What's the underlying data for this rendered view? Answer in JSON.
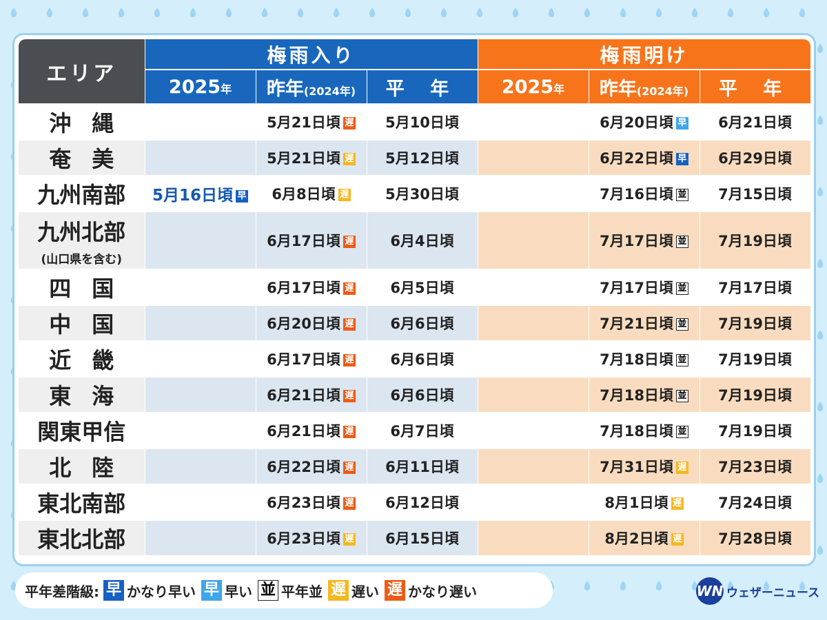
{
  "header": {
    "area_label": "エリア",
    "rainy_start_label": "梅雨入り",
    "rainy_end_label": "梅雨明け",
    "col_this_year": "2025",
    "col_year_unit": "年",
    "col_last_year": "昨年",
    "col_last_year_note": "(2024年)",
    "col_normal": "平 年"
  },
  "rows": [
    {
      "area": "沖縄",
      "spaced": true,
      "note": "",
      "in_2025": "",
      "in_2025_badge": "",
      "in_2024": "5月21日頃",
      "in_2024_badge": "遅",
      "in_2024_level": "very-late",
      "in_normal": "5月10日頃",
      "out_2025": "",
      "out_2024": "6月20日頃",
      "out_2024_badge": "早",
      "out_2024_level": "early",
      "out_normal": "6月21日頃"
    },
    {
      "area": "奄美",
      "spaced": true,
      "note": "",
      "in_2025": "",
      "in_2025_badge": "",
      "in_2024": "5月21日頃",
      "in_2024_badge": "遅",
      "in_2024_level": "late",
      "in_normal": "5月12日頃",
      "out_2025": "",
      "out_2024": "6月22日頃",
      "out_2024_badge": "早",
      "out_2024_level": "very-early",
      "out_normal": "6月29日頃"
    },
    {
      "area": "九州南部",
      "spaced": false,
      "note": "",
      "in_2025": "5月16日頃",
      "in_2025_badge": "早",
      "in_2025_level": "very-early",
      "in_2024": "6月8日頃",
      "in_2024_badge": "遅",
      "in_2024_level": "late",
      "in_normal": "5月30日頃",
      "out_2025": "",
      "out_2024": "7月16日頃",
      "out_2024_badge": "並",
      "out_2024_level": "normal",
      "out_normal": "7月15日頃"
    },
    {
      "area": "九州北部",
      "spaced": false,
      "note": "(山口県を含む)",
      "in_2025": "",
      "in_2025_badge": "",
      "in_2024": "6月17日頃",
      "in_2024_badge": "遅",
      "in_2024_level": "very-late",
      "in_normal": "6月4日頃",
      "out_2025": "",
      "out_2024": "7月17日頃",
      "out_2024_badge": "並",
      "out_2024_level": "normal",
      "out_normal": "7月19日頃"
    },
    {
      "area": "四国",
      "spaced": true,
      "note": "",
      "in_2025": "",
      "in_2025_badge": "",
      "in_2024": "6月17日頃",
      "in_2024_badge": "遅",
      "in_2024_level": "very-late",
      "in_normal": "6月5日頃",
      "out_2025": "",
      "out_2024": "7月17日頃",
      "out_2024_badge": "並",
      "out_2024_level": "normal",
      "out_normal": "7月17日頃"
    },
    {
      "area": "中国",
      "spaced": true,
      "note": "",
      "in_2025": "",
      "in_2025_badge": "",
      "in_2024": "6月20日頃",
      "in_2024_badge": "遅",
      "in_2024_level": "very-late",
      "in_normal": "6月6日頃",
      "out_2025": "",
      "out_2024": "7月21日頃",
      "out_2024_badge": "並",
      "out_2024_level": "normal",
      "out_normal": "7月19日頃"
    },
    {
      "area": "近畿",
      "spaced": true,
      "note": "",
      "in_2025": "",
      "in_2025_badge": "",
      "in_2024": "6月17日頃",
      "in_2024_badge": "遅",
      "in_2024_level": "very-late",
      "in_normal": "6月6日頃",
      "out_2025": "",
      "out_2024": "7月18日頃",
      "out_2024_badge": "並",
      "out_2024_level": "normal",
      "out_normal": "7月19日頃"
    },
    {
      "area": "東海",
      "spaced": true,
      "note": "",
      "in_2025": "",
      "in_2025_badge": "",
      "in_2024": "6月21日頃",
      "in_2024_badge": "遅",
      "in_2024_level": "very-late",
      "in_normal": "6月6日頃",
      "out_2025": "",
      "out_2024": "7月18日頃",
      "out_2024_badge": "並",
      "out_2024_level": "normal",
      "out_normal": "7月19日頃"
    },
    {
      "area": "関東甲信",
      "spaced": false,
      "note": "",
      "in_2025": "",
      "in_2025_badge": "",
      "in_2024": "6月21日頃",
      "in_2024_badge": "遅",
      "in_2024_level": "very-late",
      "in_normal": "6月7日頃",
      "out_2025": "",
      "out_2024": "7月18日頃",
      "out_2024_badge": "並",
      "out_2024_level": "normal",
      "out_normal": "7月19日頃"
    },
    {
      "area": "北陸",
      "spaced": true,
      "note": "",
      "in_2025": "",
      "in_2025_badge": "",
      "in_2024": "6月22日頃",
      "in_2024_badge": "遅",
      "in_2024_level": "very-late",
      "in_normal": "6月11日頃",
      "out_2025": "",
      "out_2024": "7月31日頃",
      "out_2024_badge": "遅",
      "out_2024_level": "late",
      "out_normal": "7月23日頃"
    },
    {
      "area": "東北南部",
      "spaced": false,
      "note": "",
      "in_2025": "",
      "in_2025_badge": "",
      "in_2024": "6月23日頃",
      "in_2024_badge": "遅",
      "in_2024_level": "very-late",
      "in_normal": "6月12日頃",
      "out_2025": "",
      "out_2024": "8月1日頃",
      "out_2024_badge": "遅",
      "out_2024_level": "late",
      "out_normal": "7月24日頃"
    },
    {
      "area": "東北北部",
      "spaced": false,
      "note": "",
      "in_2025": "",
      "in_2025_badge": "",
      "in_2024": "6月23日頃",
      "in_2024_badge": "遅",
      "in_2024_level": "late",
      "in_normal": "6月15日頃",
      "out_2025": "",
      "out_2024": "8月2日頃",
      "out_2024_badge": "遅",
      "out_2024_level": "late",
      "out_normal": "7月28日頃"
    }
  ],
  "legend": {
    "title": "平年差階級:",
    "items": [
      {
        "badge": "早",
        "level": "very-early",
        "label": "かなり早い"
      },
      {
        "badge": "早",
        "level": "early",
        "label": "早い"
      },
      {
        "badge": "並",
        "level": "normal",
        "label": "平年並"
      },
      {
        "badge": "遅",
        "level": "late",
        "label": "遅い"
      },
      {
        "badge": "遅",
        "level": "very-late",
        "label": "かなり遅い"
      }
    ]
  },
  "logo": {
    "mark": "WN",
    "text": "ウェザーニュース"
  },
  "colors": {
    "rainy_start": "#1867bd",
    "rainy_end": "#f7741b",
    "very_early": "#1760c4",
    "early": "#3ea6ea",
    "late": "#f5b820",
    "very_late": "#ee5a14",
    "background": "#d4eefb"
  }
}
